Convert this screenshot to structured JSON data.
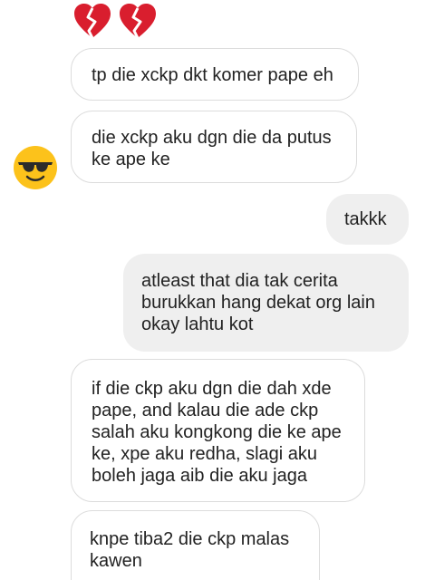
{
  "conversation": {
    "top_reaction_icons": [
      "broken-heart-icon",
      "broken-heart-icon"
    ],
    "avatar_icon": "sunglasses-smiley-icon",
    "messages": [
      {
        "direction": "incoming",
        "text": "tp die xckp dkt komer pape eh"
      },
      {
        "direction": "incoming",
        "text": "die xckp aku dgn die da putus\nke ape ke"
      },
      {
        "direction": "outgoing",
        "text": "takkk"
      },
      {
        "direction": "outgoing",
        "text": "atleast that dia tak cerita\nburukkan hang dekat org lain\nokay lahtu kot"
      },
      {
        "direction": "incoming",
        "text": "if die ckp aku dgn die dah xde\npape, and kalau die ade ckp\nsalah aku kongkong die ke ape\nke, xpe aku redha, slagi aku\nboleh jaga aib die aku jaga"
      },
      {
        "direction": "incoming",
        "text": "knpe tiba2 die ckp malas\nkawen"
      }
    ]
  }
}
